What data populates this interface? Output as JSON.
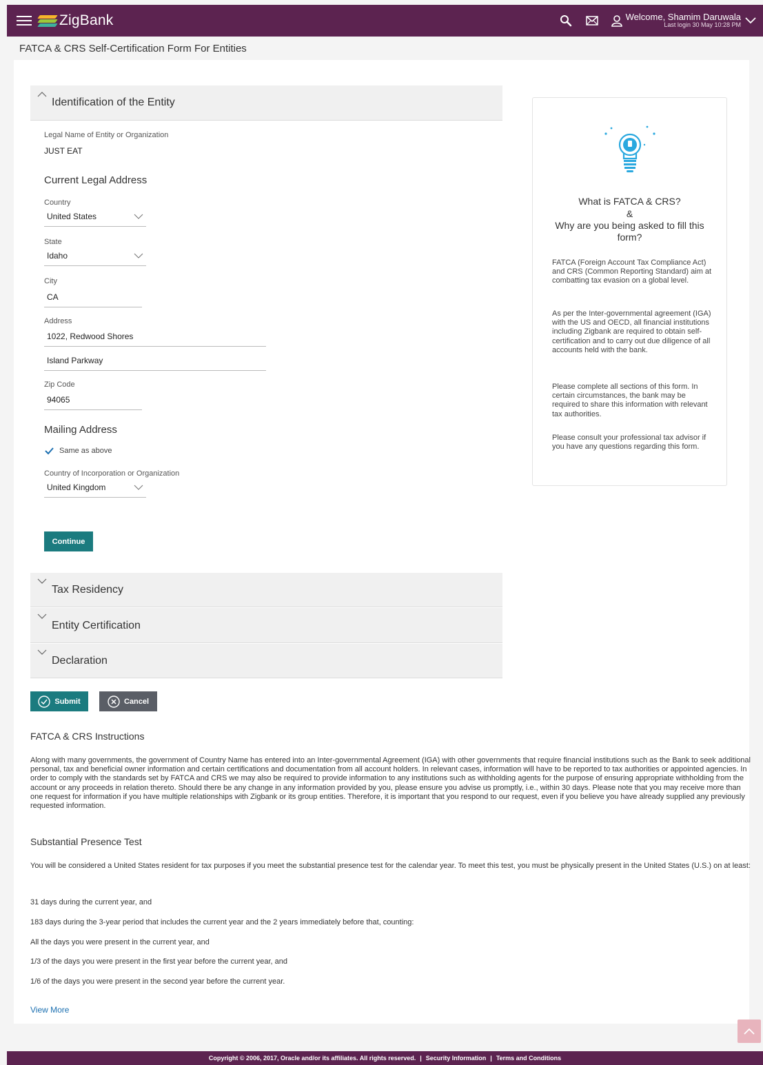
{
  "header": {
    "brand": "ZigBank",
    "welcome": "Welcome, Shamim Daruwala",
    "last_login": "Last login 30 May 10:28 PM",
    "color": "#5c2350"
  },
  "page": {
    "title": "FATCA & CRS Self-Certification Form For Entities"
  },
  "identification": {
    "section_title": "Identification of the Entity",
    "legal_name_label": "Legal Name of Entity or Organization",
    "legal_name_value": "JUST EAT",
    "current_address_heading": "Current Legal Address",
    "country_label": "Country",
    "country_value": "United States",
    "state_label": "State",
    "state_value": "Idaho",
    "city_label": "City",
    "city_value": "CA",
    "address_label": "Address",
    "address_line1": "1022, Redwood Shores",
    "address_line2": "Island Parkway",
    "zip_label": "Zip Code",
    "zip_value": "94065",
    "mailing_heading": "Mailing Address",
    "same_as_above": "Same as above",
    "same_as_above_checked": true,
    "incorporation_label": "Country of Incorporation or Organization",
    "incorporation_value": "United Kingdom",
    "continue_label": "Continue"
  },
  "collapsed_sections": {
    "tax_residency": "Tax Residency",
    "entity_certification": "Entity Certification",
    "declaration": "Declaration"
  },
  "actions": {
    "submit": "Submit",
    "cancel": "Cancel"
  },
  "info_card": {
    "title_line1": "What is FATCA & CRS?",
    "title_line2": "&",
    "title_line3": "Why are you being asked to fill this form?",
    "p1": "FATCA (Foreign Account Tax Compliance Act) and CRS (Common Reporting Standard) aim at combatting tax evasion on a global level.",
    "p2": "As per the Inter-governmental agreement (IGA) with the US and OECD, all financial institutions including Zigbank are required to obtain self-certification and to carry out due diligence of all accounts held with the bank.",
    "p3": "Please complete all sections of this form. In certain circumstances, the bank may be required to share this information with relevant tax authorities.",
    "p4": "Please consult your professional tax advisor if you have any questions regarding this form."
  },
  "instructions": {
    "heading": "FATCA & CRS Instructions",
    "body": "Along with many governments, the government of Country Name has entered into an Inter-governmental Agreement (IGA) with other governments that require financial institutions such as the Bank to seek additional personal, tax and beneficial owner information and certain certifications and documentation from all account holders. In relevant cases, information will have to be reported to tax authorities or appointed agencies. In order to comply with the standards set by FATCA and CRS we may also be required to provide information to any institutions such as withholding agents for the purpose of ensuring appropriate withholding from the account or any proceeds in relation thereto. Should there be any change in any information provided by you, please ensure you advise us promptly, i.e., within 30 days. Please note that you may receive more than one request for information if you have multiple relationships with Zigbank or its group entities. Therefore, it is important that you respond to our request, even if you believe you have already supplied any previously requested information.",
    "spt_heading": "Substantial Presence Test",
    "spt_body": "You will be considered a United States resident for tax purposes if you meet the substantial presence test for the calendar year. To meet this test, you must be physically present in the United States (U.S.) on at least:",
    "spt_items": [
      "31 days during the current year, and",
      "183 days during the 3-year period that includes the current year and the 2 years immediately before that, counting:",
      "All the days you were present in the current year, and",
      "1/3 of the days you were present in the first year before the current year, and",
      "1/6 of the days you were present in the second year before the current year."
    ],
    "view_more": "View More"
  },
  "footer": {
    "copyright": "Copyright © 2006, 2017, Oracle and/or its affiliates. All rights reserved.",
    "sep": "|",
    "security": "Security Information",
    "terms": "Terms and Conditions"
  }
}
